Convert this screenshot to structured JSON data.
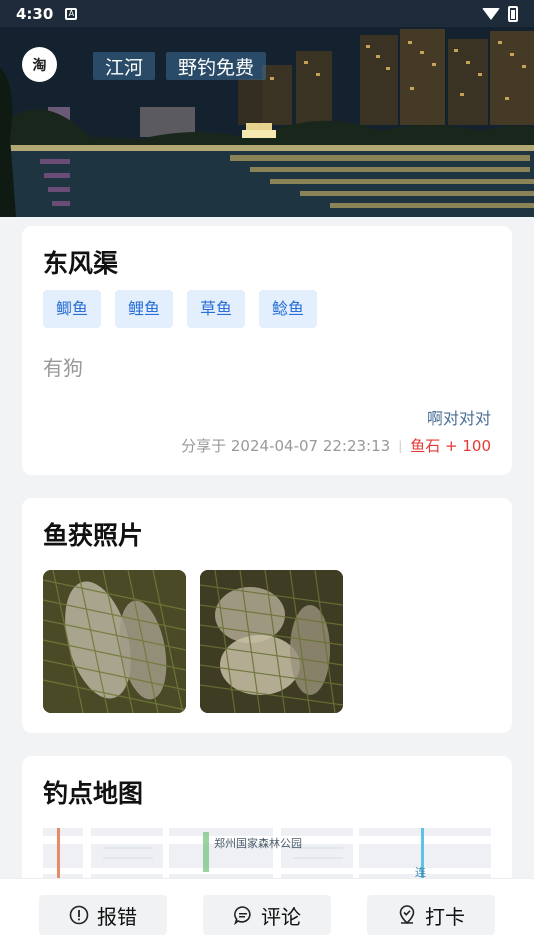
{
  "status_bar": {
    "time": "4:30",
    "indicator": "A"
  },
  "hero": {
    "badge": "淘",
    "water_type": "江河",
    "fee_type": "野钓免费"
  },
  "spot": {
    "name": "东风渠",
    "fish": [
      "鲫鱼",
      "鲤鱼",
      "草鱼",
      "鲶鱼"
    ],
    "description": "有狗",
    "author": "啊对对对",
    "shared_label": "分享于 2024-04-07 22:23:13",
    "separator": "|",
    "reward": "鱼石 + 100"
  },
  "photos": {
    "title": "鱼获照片",
    "count": 2
  },
  "map": {
    "title": "钓点地图",
    "poi_label": "郑州国家森林公园",
    "road_label": "连"
  },
  "actions": {
    "report": "报错",
    "comment": "评论",
    "checkin": "打卡"
  },
  "colors": {
    "tag_bg": "#e4effd",
    "tag_text": "#2a6fd6",
    "reward": "#e53935",
    "author": "#4a6e95"
  }
}
